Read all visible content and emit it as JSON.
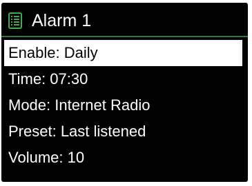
{
  "header": {
    "title": "Alarm 1",
    "icon": "list-icon",
    "icon_color": "#3fae49"
  },
  "divider_color": "#2e7d32",
  "menu": {
    "selected_index": 0,
    "items": [
      {
        "label": "Enable:",
        "value": "Daily"
      },
      {
        "label": "Time:",
        "value": "07:30"
      },
      {
        "label": "Mode:",
        "value": "Internet Radio"
      },
      {
        "label": "Preset:",
        "value": "Last listened"
      },
      {
        "label": "Volume:",
        "value": "10"
      }
    ]
  }
}
